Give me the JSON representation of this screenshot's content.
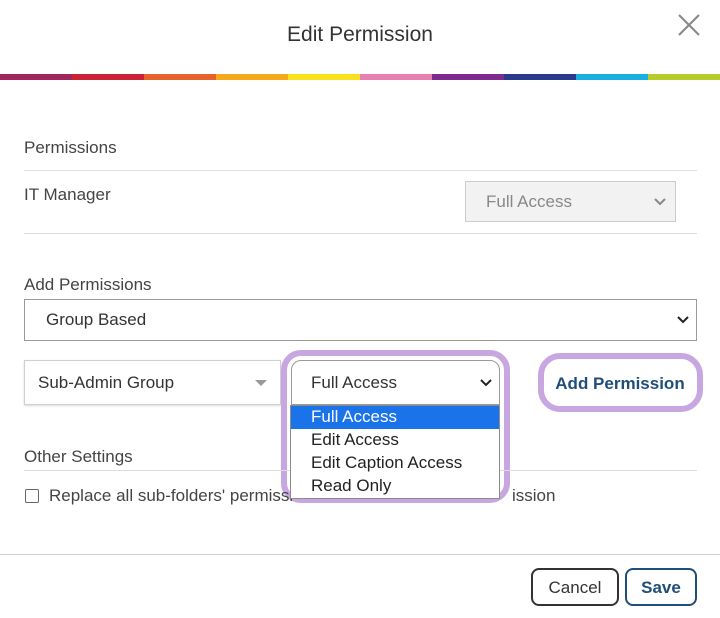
{
  "dialog": {
    "title": "Edit Permission",
    "close_icon": "close-icon"
  },
  "rainbow": [
    "#a0265e",
    "#cc2236",
    "#e8632b",
    "#f7a91c",
    "#f9e11e",
    "#e77fb1",
    "#7e2a8e",
    "#2b3a8d",
    "#17b0e0",
    "#b6cc2a"
  ],
  "permissions": {
    "heading": "Permissions",
    "items": [
      {
        "name": "IT Manager",
        "access": "Full Access"
      }
    ]
  },
  "add_permissions": {
    "heading": "Add Permissions",
    "type_select": "Group Based",
    "group_select": "Sub-Admin Group",
    "access_select": "Full Access",
    "access_options": [
      "Full Access",
      "Edit Access",
      "Edit Caption Access",
      "Read Only"
    ],
    "selected_option_index": 0,
    "add_button": "Add Permission"
  },
  "other_settings": {
    "heading": "Other Settings",
    "checkbox_label_left": "Replace all sub-folders' permissi",
    "checkbox_label_right": "ission",
    "checked": false
  },
  "footer": {
    "cancel": "Cancel",
    "save": "Save"
  },
  "colors": {
    "accent": "#1f4e79",
    "highlight": "#c8a6e0",
    "option_selected": "#1a73e8"
  }
}
